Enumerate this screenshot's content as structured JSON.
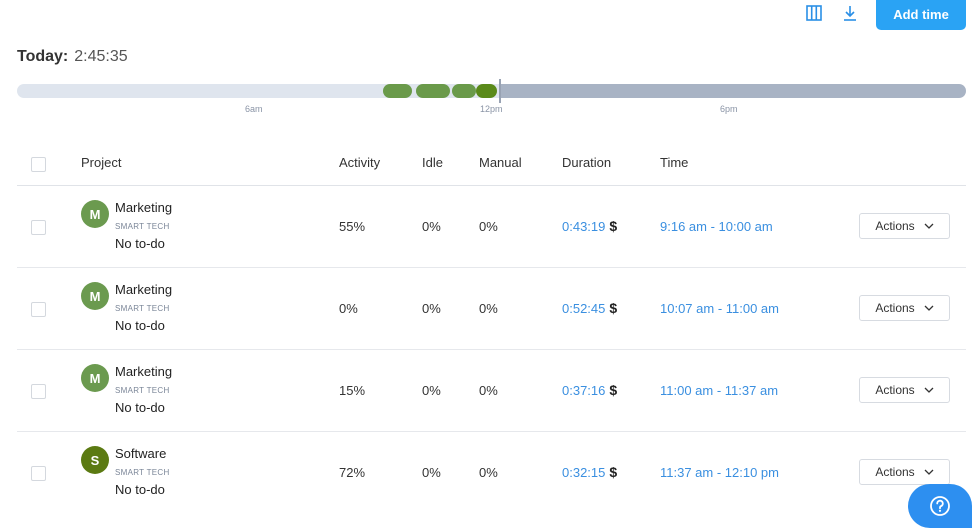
{
  "toolbar": {
    "columns_icon": "columns-icon",
    "download_icon": "download-icon",
    "add_time_label": "Add time"
  },
  "today": {
    "label": "Today:",
    "value": "2:45:35"
  },
  "timeline": {
    "ticks": [
      "6am",
      "12pm",
      "6pm"
    ],
    "activity_color": "#6a9a4a",
    "dark_color": "#5a8a1a"
  },
  "table": {
    "headers": {
      "project": "Project",
      "activity": "Activity",
      "idle": "Idle",
      "manual": "Manual",
      "duration": "Duration",
      "time": "Time"
    },
    "rows": [
      {
        "initial": "M",
        "avatar_color": "#6b9a4f",
        "project": "Marketing",
        "org": "SMART TECH",
        "todo": "No to-do",
        "activity": "55%",
        "idle": "0%",
        "manual": "0%",
        "duration": "0:43:19",
        "currency": "$",
        "time": "9:16 am - 10:00 am",
        "actions": "Actions"
      },
      {
        "initial": "M",
        "avatar_color": "#6b9a4f",
        "project": "Marketing",
        "org": "SMART TECH",
        "todo": "No to-do",
        "activity": "0%",
        "idle": "0%",
        "manual": "0%",
        "duration": "0:52:45",
        "currency": "$",
        "time": "10:07 am - 11:00 am",
        "actions": "Actions"
      },
      {
        "initial": "M",
        "avatar_color": "#6b9a4f",
        "project": "Marketing",
        "org": "SMART TECH",
        "todo": "No to-do",
        "activity": "15%",
        "idle": "0%",
        "manual": "0%",
        "duration": "0:37:16",
        "currency": "$",
        "time": "11:00 am - 11:37 am",
        "actions": "Actions"
      },
      {
        "initial": "S",
        "avatar_color": "#5b7a12",
        "project": "Software",
        "org": "SMART TECH",
        "todo": "No to-do",
        "activity": "72%",
        "idle": "0%",
        "manual": "0%",
        "duration": "0:32:15",
        "currency": "$",
        "time": "11:37 am - 12:10 pm",
        "actions": "Actions"
      }
    ]
  },
  "help": {
    "icon": "help-question-icon"
  },
  "colors": {
    "accent": "#2aa3f4",
    "link": "#3a8fe0"
  }
}
